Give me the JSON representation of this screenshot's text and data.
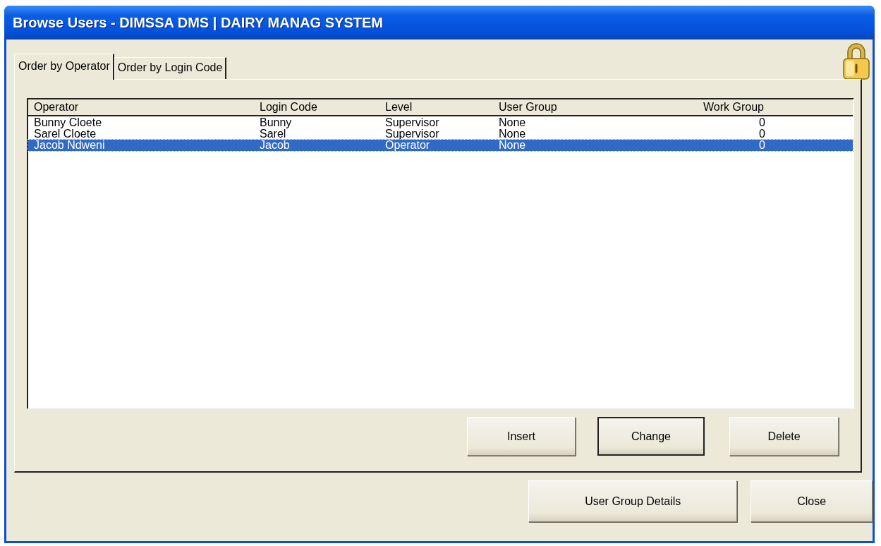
{
  "window": {
    "title": "Browse Users - DIMSSA DMS | DAIRY MANAG SYSTEM"
  },
  "tabs": [
    {
      "label": "Order by Operator",
      "selected": true
    },
    {
      "label": "Order by Login Code",
      "selected": false
    }
  ],
  "table": {
    "columns": [
      "Operator",
      "Login Code",
      "Level",
      "User Group",
      "Work Group"
    ],
    "rows": [
      {
        "cells": [
          "Bunny Cloete",
          "Bunny",
          "Supervisor",
          "None",
          "0"
        ],
        "selected": false
      },
      {
        "cells": [
          "Sarel Cloete",
          "Sarel",
          "Supervisor",
          "None",
          "0"
        ],
        "selected": false
      },
      {
        "cells": [
          "Jacob Ndweni",
          "Jacob",
          "Operator",
          "None",
          "0"
        ],
        "selected": true
      }
    ]
  },
  "panel_buttons": [
    {
      "label": "Insert",
      "default": false
    },
    {
      "label": "Change",
      "default": true
    },
    {
      "label": "Delete",
      "default": false
    }
  ],
  "footer_buttons": [
    {
      "label": "User Group Details",
      "default": false
    },
    {
      "label": "Close",
      "default": false
    }
  ]
}
